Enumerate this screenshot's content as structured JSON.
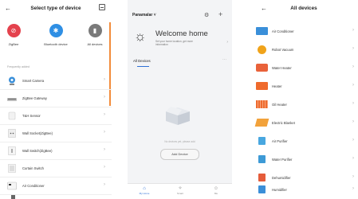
{
  "screen1": {
    "title": "Select type of device",
    "categories": [
      {
        "label": "ZigBee",
        "color": "#e4424d",
        "glyph": "⊘"
      },
      {
        "label": "Bluetooth device",
        "color": "#2f8fe4",
        "glyph": "✱"
      },
      {
        "label": "All devices",
        "color": "#7a7a7a",
        "glyph": "▮"
      }
    ],
    "section_label": "Frequently added",
    "items": [
      "Smart Camera",
      "ZigBee Gateway",
      "T&H Sensor",
      "Wall Socket(ZigBee)",
      "Wall Switch(ZigBee)",
      "Curtain Switch",
      "Air Conditioner"
    ],
    "accent": "#f28c3b"
  },
  "screen2": {
    "home_name": "Panamalar",
    "welcome_title": "Welcome home",
    "welcome_sub": "Set your home location, get more information",
    "tab_label": "All Devices",
    "empty_text": "No devices yet, please add",
    "add_button": "Add Device",
    "tabs": [
      "My Home",
      "Smart",
      "Me"
    ],
    "accent": "#2d6fd6"
  },
  "screen3": {
    "title": "All devices",
    "items": [
      {
        "label": "Air Conditioner",
        "color": "#3a8fd9"
      },
      {
        "label": "Robot Vacuum",
        "color": "#f0a31a"
      },
      {
        "label": "Water Heater",
        "color": "#e9623a"
      },
      {
        "label": "Heater",
        "color": "#ef6a2c"
      },
      {
        "label": "Oil Heater",
        "color": "#ee6b2e"
      },
      {
        "label": "Electric Blanket",
        "color": "#f2a23b"
      },
      {
        "label": "Air Purifier",
        "color": "#48a7e0"
      },
      {
        "label": "Water Purifier",
        "color": "#3d9ad6"
      },
      {
        "label": "Dehumidifier",
        "color": "#e55c3a"
      },
      {
        "label": "Humidifier",
        "color": "#3b8fd8"
      }
    ]
  }
}
